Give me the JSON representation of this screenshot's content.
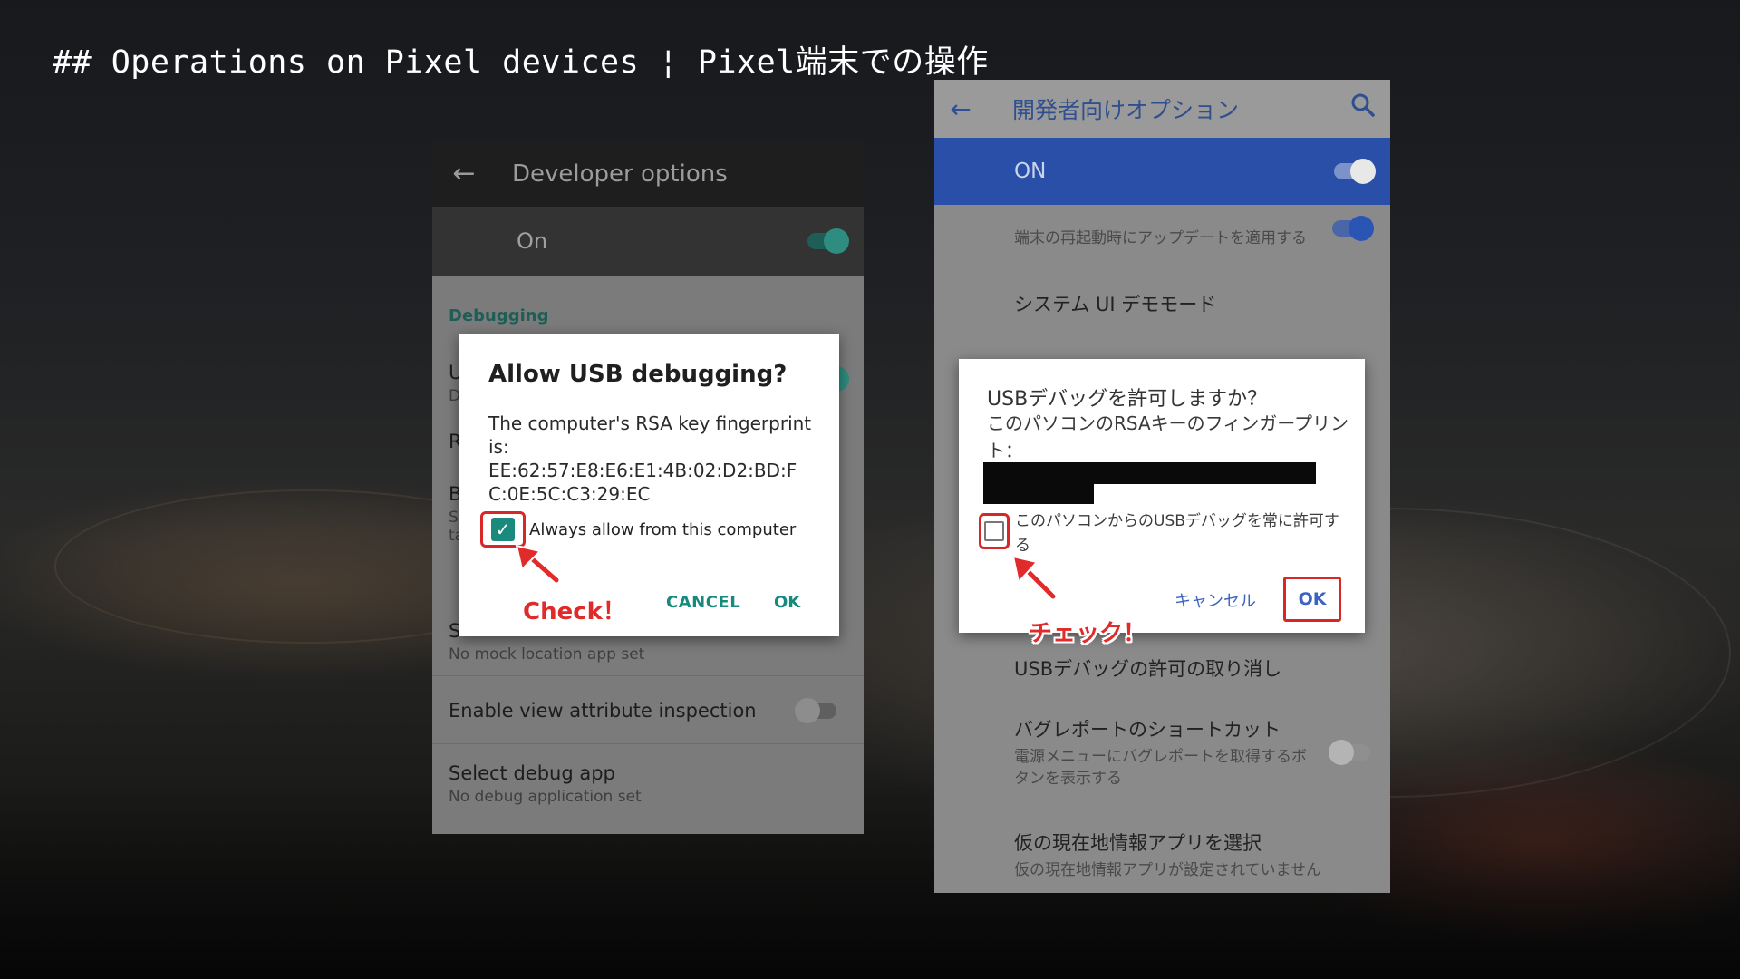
{
  "slide": {
    "title": "## Operations on Pixel devices ¦ Pixel端末での操作"
  },
  "left_phone": {
    "toolbar_title": "Developer options",
    "master_switch_label": "On",
    "section_header": "Debugging",
    "rows": {
      "mock_location_title": "S",
      "mock_location_sub": "No mock location app set",
      "view_attr_title": "Enable view attribute inspection",
      "debug_app_title": "Select debug app",
      "debug_app_sub": "No debug application set"
    },
    "partial_rows": [
      "U",
      "D",
      "R",
      "B",
      "S",
      "ta"
    ],
    "dialog": {
      "title": "Allow USB debugging?",
      "body_line1": "The computer's RSA key fingerprint is:",
      "fingerprint": "EE:62:57:E8:E6:E1:4B:02:D2:BD:FC:0E:5C:C3:29:EC",
      "checkbox_label": "Always allow from this computer",
      "checkbox_checked": true,
      "cancel_label": "CANCEL",
      "ok_label": "OK"
    },
    "annotation": "Check！"
  },
  "right_phone": {
    "toolbar_title": "開発者向けオプション",
    "master_switch_label": "ON",
    "rows": {
      "auto_update_title": "端末の再起動時にアップデートを適用する",
      "demo_mode_title": "システム UI デモモード",
      "revoke_title": "USBデバッグの許可の取り消し",
      "bugreport_title": "バグレポートのショートカット",
      "bugreport_sub": "電源メニューにバグレポートを取得するボタンを表示する",
      "mock_location_title": "仮の現在地情報アプリを選択",
      "mock_location_sub": "仮の現在地情報アプリが設定されていません"
    },
    "dialog": {
      "title": "USBデバッグを許可しますか？",
      "body": "このパソコンのRSAキーのフィンガープリント：",
      "checkbox_label": "このパソコンからのUSBデバッグを常に許可する",
      "checkbox_checked": false,
      "cancel_label": "キャンセル",
      "ok_label": "OK"
    },
    "annotation": "チェック！"
  },
  "colors": {
    "annotation_red": "#d92626",
    "teal_accent": "#158a7d",
    "blue_accent": "#2a4fa8"
  },
  "icons": {
    "back": "arrow-left",
    "search": "magnifier",
    "check": "checkmark"
  }
}
